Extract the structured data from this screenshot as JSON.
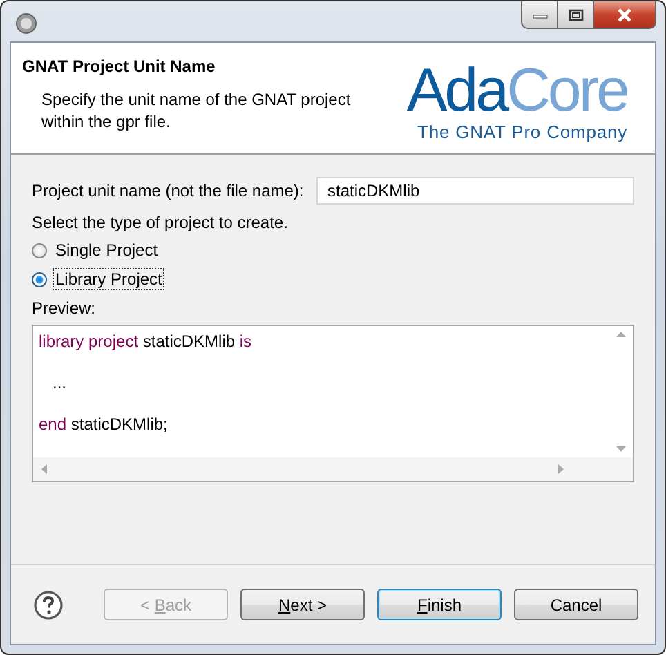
{
  "header": {
    "title": "GNAT Project Unit Name",
    "description": "Specify the unit name of the GNAT project within the gpr file.",
    "logo": {
      "wordmark_dark": "Ada",
      "wordmark_light": "Core",
      "tagline": "The GNAT Pro Company"
    }
  },
  "unit_name": {
    "label": "Project unit name (not the file name):",
    "value": "staticDKMlib"
  },
  "project_type": {
    "label": "Select the type of project to create.",
    "options": [
      {
        "label": "Single Project",
        "selected": false
      },
      {
        "label": "Library Project",
        "selected": true
      }
    ]
  },
  "preview": {
    "label": "Preview:",
    "lines": [
      {
        "tokens": [
          {
            "kind": "keyword",
            "text": "library project"
          },
          {
            "kind": "plain",
            "text": " staticDKMlib "
          },
          {
            "kind": "keyword",
            "text": "is"
          }
        ]
      },
      {
        "tokens": [
          {
            "kind": "plain",
            "text": "   ..."
          }
        ]
      },
      {
        "tokens": [
          {
            "kind": "keyword",
            "text": "end"
          },
          {
            "kind": "plain",
            "text": " staticDKMlib;"
          }
        ]
      }
    ]
  },
  "buttons": [
    {
      "label_start": "< ",
      "mnemonic": "B",
      "label_end": "ack",
      "disabled": true,
      "default": false
    },
    {
      "mnemonic": "N",
      "label_end": "ext >",
      "disabled": false,
      "default": false
    },
    {
      "mnemonic": "F",
      "label_end": "inish",
      "disabled": false,
      "default": true
    },
    {
      "label_start": "Cancel",
      "disabled": false,
      "default": false
    }
  ]
}
